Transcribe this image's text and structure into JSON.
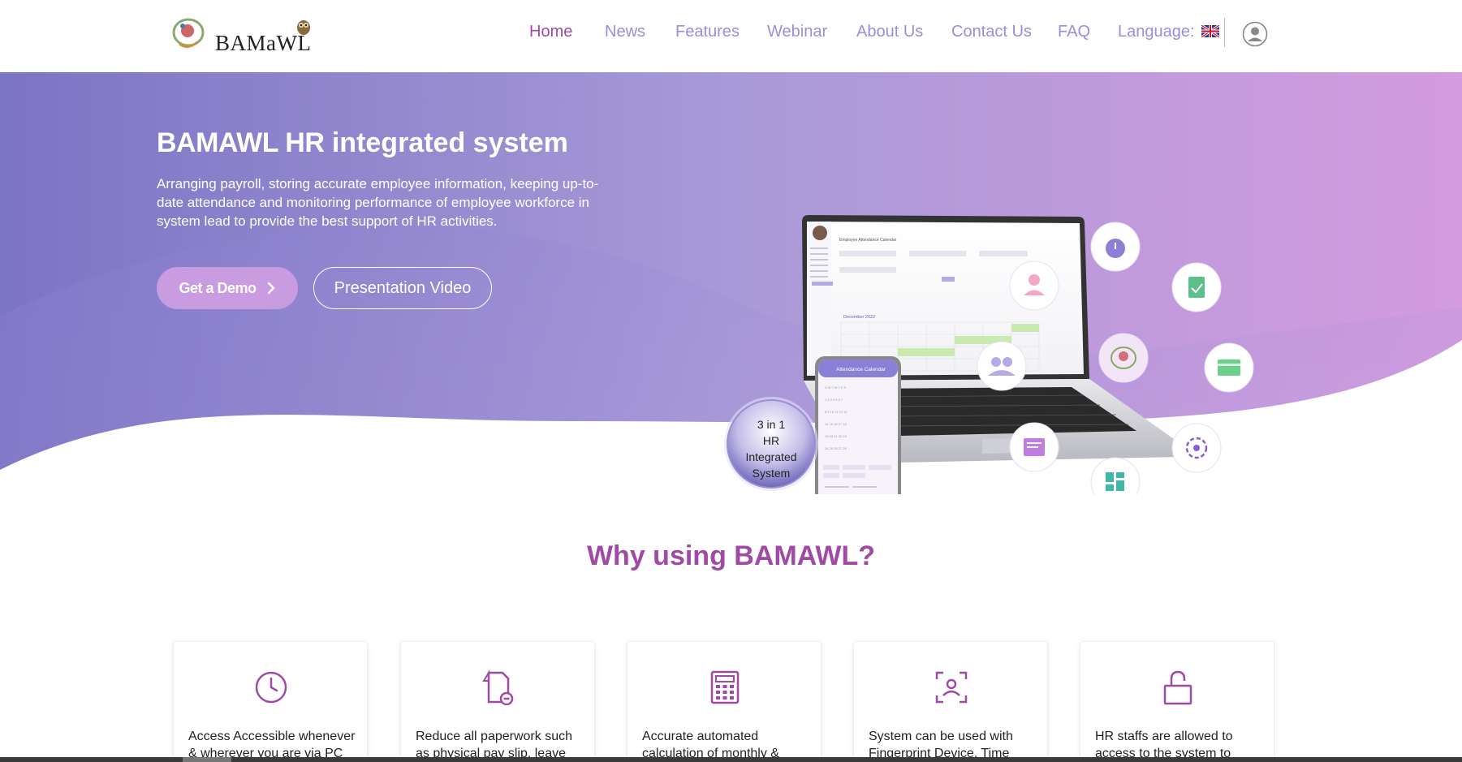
{
  "header": {
    "logo_text": "BAMaWL",
    "nav": [
      {
        "label": "Home",
        "active": true
      },
      {
        "label": "News"
      },
      {
        "label": "Features"
      },
      {
        "label": "Webinar"
      },
      {
        "label": "About Us"
      },
      {
        "label": "Contact Us"
      },
      {
        "label": "FAQ"
      },
      {
        "label": "Language:"
      }
    ],
    "language_flag_icon": "uk-flag-icon",
    "account_icon": "user-circle-icon"
  },
  "hero": {
    "title_bold": "BAMAWL HR",
    "title_rest": " integrated system",
    "description": "Arranging payroll, storing accurate employee information, keeping up-to-date attendance and monitoring performance of employee workforce in system lead to provide the best support of HR activities.",
    "demo_button": "Get a Demo",
    "video_button": "Presentation Video",
    "badge_line1": "3 in 1",
    "badge_line2": "HR",
    "badge_line3": "Integrated",
    "badge_line4": "System",
    "phone_header": "Attendance Calendar",
    "laptop_title": "Employee Attendance Calendar",
    "laptop_month": "December 2022"
  },
  "why": {
    "title": "Why using BAMAWL?",
    "cards": [
      {
        "icon": "clock-icon",
        "text": "Access Accessible whenever & wherever you are via PC"
      },
      {
        "icon": "document-remove-icon",
        "text": "Reduce all paperwork such as physical pay slip, leave form"
      },
      {
        "icon": "calculator-icon",
        "text": "Accurate automated calculation of monthly &"
      },
      {
        "icon": "face-scan-icon",
        "text": "System can be used with Fingerprint Device, Time Card"
      },
      {
        "icon": "unlock-icon",
        "text": "HR staffs are allowed to access to the system to"
      }
    ]
  },
  "colors": {
    "accent": "#a04aa6",
    "nav": "#9b8ed9",
    "hero_start": "#7c74c4",
    "hero_end": "#d49be0"
  }
}
